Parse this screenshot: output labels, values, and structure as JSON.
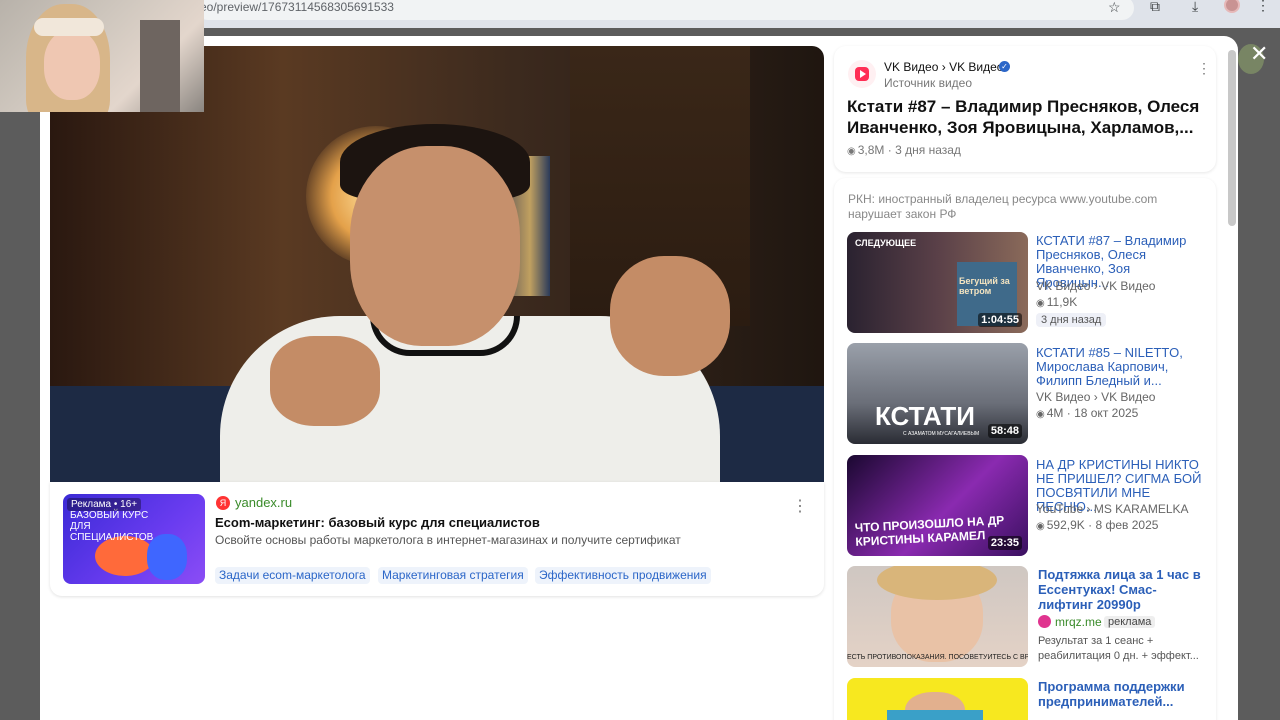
{
  "browser": {
    "url": "eo/preview/17673114568305691533"
  },
  "video_info": {
    "channel": "VK Видео › VK Видео",
    "channel_sub": "Источник видео",
    "title": "Кстати #87 – Владимир Пресняков, Олеся Иванченко, Зоя Яровицына, Харламов,...",
    "views": "3,8M",
    "age": "3 дня назад"
  },
  "ad": {
    "thumb_badge": "Реклама • 16+",
    "thumb_title": "БАЗОВЫЙ КУРС ДЛЯ СПЕЦИАЛИСТОВ",
    "domain": "yandex.ru",
    "title": "Ecom-маркетинг: базовый курс для специалистов",
    "description": "Освойте основы работы маркетолога в интернет-магазинах и получите сертификат",
    "tags": [
      "Задачи ecom-маркетолога",
      "Маркетинговая стратегия",
      "Эффективность продвижения"
    ]
  },
  "rkn_note": "РКН: иностранный владелец ресурса www.youtube.com нарушает закон РФ",
  "related": [
    {
      "next_label": "СЛЕДУЮЩЕЕ",
      "duration": "1:04:55",
      "title": "КСТАТИ #87 – Владимир Пресняков, Олеся Иванченко, Зоя Яровицын...",
      "channel": "VK Видео › VK Видео",
      "views": "11,9K",
      "date": "",
      "badge": "3 дня назад",
      "thumb_text": "Бегущий за ветром",
      "colors": [
        "#2a2230",
        "#5a4048",
        "#8a6a5a"
      ]
    },
    {
      "duration": "58:48",
      "title": "КСТАТИ #85 – NILETTO, Мирослава Карпович, Филипп Бледный и...",
      "channel": "VK Видео › VK Видео",
      "views": "4M",
      "date": "18 окт 2025",
      "thumb_text": "КСТАТИ",
      "thumb_sub": "С АЗАМАТОМ МУСАГАЛИЕВЫМ",
      "colors": [
        "#6a6e78",
        "#9aa0aa",
        "#2a2c34"
      ]
    },
    {
      "duration": "23:35",
      "title": "НА ДР КРИСТИНЫ НИКТО НЕ ПРИШЕЛ? СИГМА БОЙ ПОСВЯТИЛИ МНЕ ПЕСНЮ...",
      "channel": "YouTube › MS KARAMELKA",
      "views": "592,9K",
      "date": "8 фев 2025",
      "thumb_text": "ЧТО ПРОИЗОШЛО НА ДР КРИСТИНЫ КАРАМЕЛ",
      "colors": [
        "#3a1060",
        "#8a2ab0",
        "#1a0830"
      ]
    }
  ],
  "related_ads": [
    {
      "title": "Подтяжка лица за 1 час в Ессентуках! Смас-лифтинг 20990р",
      "source": "mrqz.me",
      "label": "реклама",
      "description": "Результат за 1 сеанс + реабилитация 0 дн. + эффект...",
      "thumb_caption": "ЕСТЬ ПРОТИВОПОКАЗАНИЯ. ПОСОВЕТУЙТЕСЬ С ВРАЧОМ"
    },
    {
      "title": "Программа поддержки предпринимателей..."
    }
  ]
}
